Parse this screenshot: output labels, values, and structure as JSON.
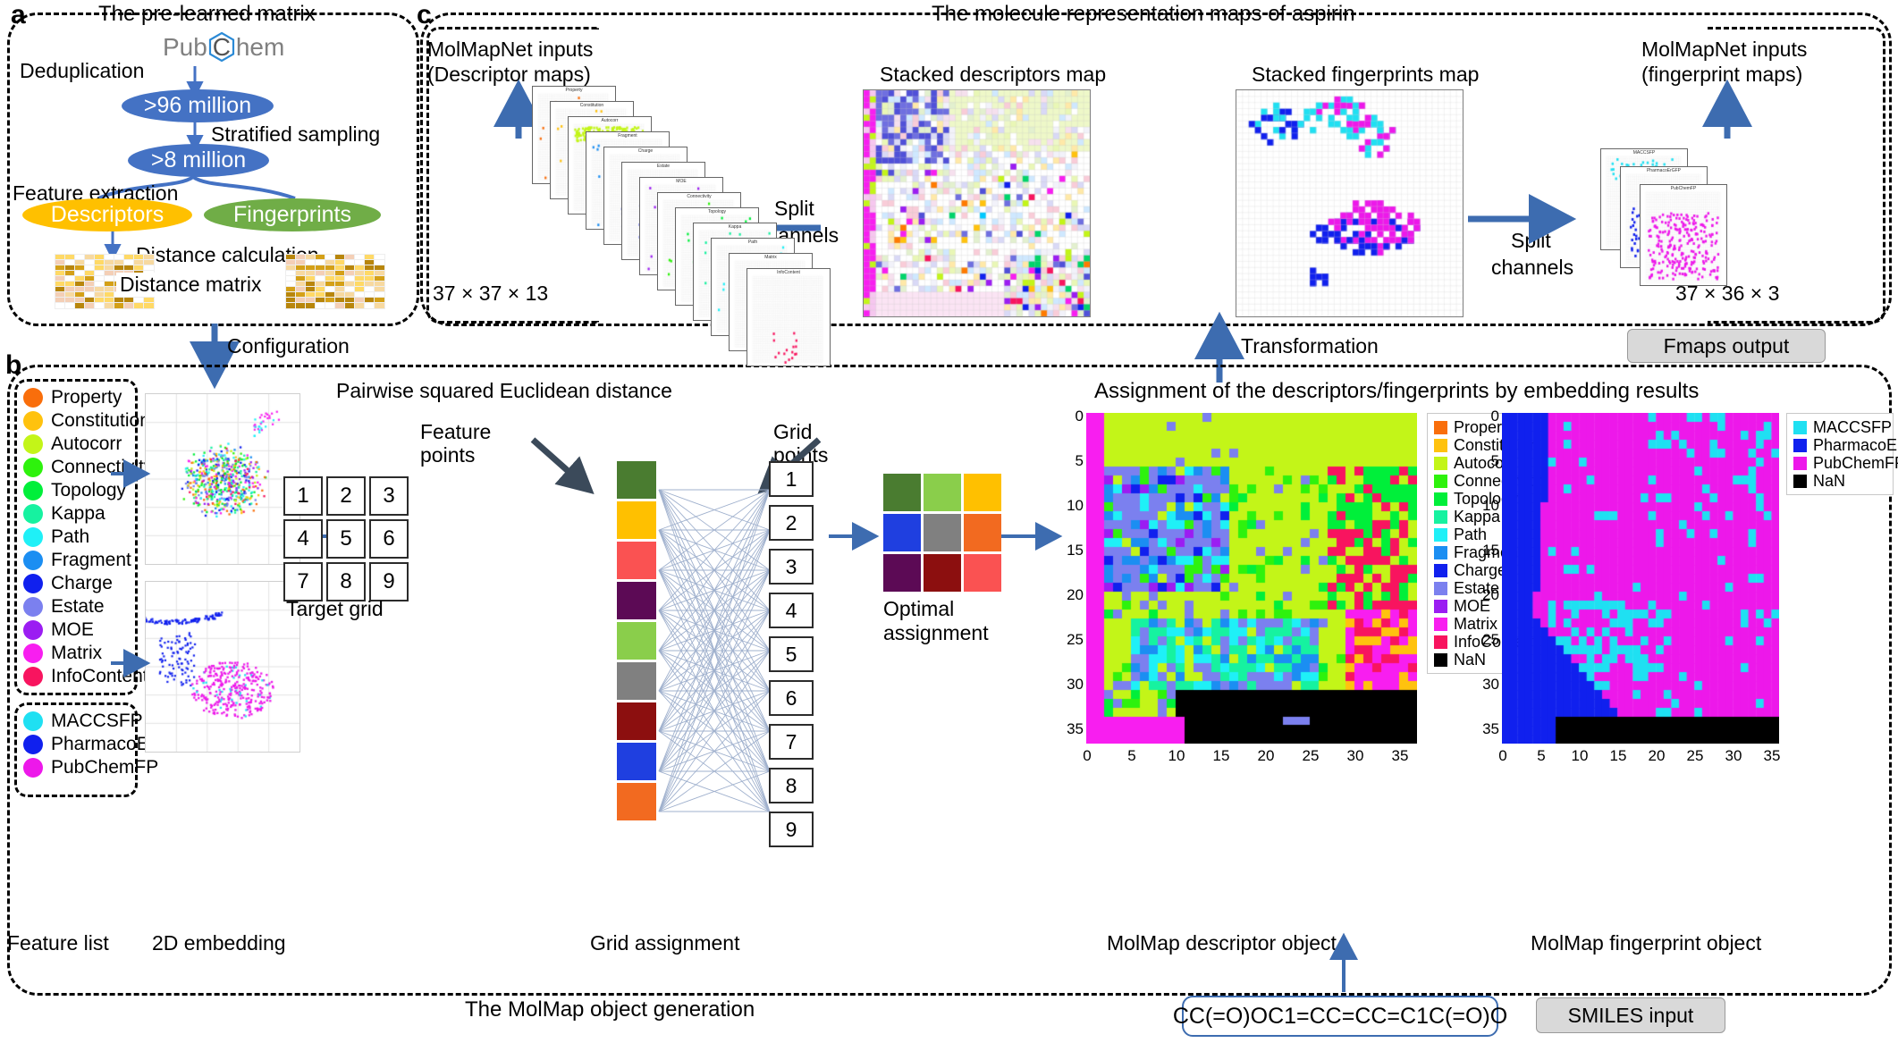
{
  "panels": {
    "a": {
      "letter": "a",
      "title": "The pre-learned matrix"
    },
    "b": {
      "letter": "b"
    },
    "c": {
      "letter": "c",
      "title": "The molecule representation maps of aspirin"
    }
  },
  "panel_a": {
    "source_label": "PubChem",
    "source_prefix": "Pub",
    "source_atom": "C",
    "source_suffix": "hem",
    "step1": "Deduplication",
    "node1": "&gt;96 million",
    "step2": "Stratified sampling",
    "node2": "&gt;8 million",
    "step3": "Feature extraction",
    "branch_left": "Descriptors",
    "branch_right": "Fingerprints",
    "step4": "Distance calculation",
    "matrix_label": "Distance matrix",
    "configuration": "Configuration"
  },
  "panel_b": {
    "feature_list_label": "Feature list",
    "embedding_label": "2D embedding",
    "grid_assignment_label": "Grid assignment",
    "target_grid_label": "Target grid",
    "pairwise_label": "Pairwise squared Euclidean distance",
    "feature_points_label": "Feature points",
    "grid_points_label": "Grid points",
    "optimal_label": "Optimal assignment",
    "assignment_title": "Assignment of the descriptors/fingerprints by embedding results",
    "descriptor_object_label": "MolMap descriptor object",
    "fingerprint_object_label": "MolMap fingerprint object",
    "generation_label": "The MolMap object generation",
    "smiles": "CC(=O)OC1=CC=CC=C1C(=O)O",
    "smiles_tag": "SMILES input",
    "target_grid_cells": [
      "1",
      "2",
      "3",
      "4",
      "5",
      "6",
      "7",
      "8",
      "9"
    ],
    "grid_points_cells": [
      "1",
      "2",
      "3",
      "4",
      "5",
      "6",
      "7",
      "8",
      "9"
    ],
    "feature_point_colors": [
      "#4a7c30",
      "#ffc000",
      "#fa5252",
      "#5c0a55",
      "#8ace4b",
      "#808080",
      "#8c0f0f",
      "#1f3fe0",
      "#f26a20"
    ],
    "optimal_colors": [
      "#4a7c30",
      "#8ace4b",
      "#ffc000",
      "#1f3fe0",
      "#808080",
      "#f26a20",
      "#5c0a55",
      "#8c0f0f",
      "#fa5252"
    ],
    "descriptor_axis_ticks": [
      "0",
      "5",
      "10",
      "15",
      "20",
      "25",
      "30",
      "35"
    ],
    "fingerprint_axis_ticks": [
      "0",
      "5",
      "10",
      "15",
      "20",
      "25",
      "30",
      "35"
    ]
  },
  "panel_c": {
    "descriptor_input_title_l1": "MolMapNet inputs",
    "descriptor_input_title_l2": "(Descriptor maps)",
    "descriptor_dims": "37 × 37 × 13",
    "stacked_descriptors_title": "Stacked descriptors map",
    "stacked_fingerprints_title": "Stacked fingerprints map",
    "fingerprint_input_title_l1": "MolMapNet inputs",
    "fingerprint_input_title_l2": "(fingerprint maps)",
    "fingerprint_dims": "37 × 36 × 3",
    "split_channels_left_l1": "Split",
    "split_channels_left_l2": "channels",
    "split_channels_right_l1": "Split",
    "split_channels_right_l2": "channels",
    "transformation_label": "Transformation",
    "fmaps_tag": "Fmaps output",
    "descriptor_card_labels": [
      "Property",
      "Constitution",
      "Autocorr",
      "Fragment",
      "Charge",
      "Estate",
      "MOE",
      "Connectivity",
      "Topology",
      "Kappa",
      "Path",
      "Matrix",
      "InfoContent"
    ],
    "fingerprint_card_labels": [
      "MACCSFP",
      "PharmacoErGFP",
      "PubChemFP"
    ]
  },
  "feature_list": {
    "descriptors": [
      {
        "label": "Property",
        "color": "#f96e0b"
      },
      {
        "label": "Constitution",
        "color": "#ffc20e"
      },
      {
        "label": "Autocorr",
        "color": "#c3f518"
      },
      {
        "label": "Connectivity",
        "color": "#2ef20d"
      },
      {
        "label": "Topology",
        "color": "#00ef3a"
      },
      {
        "label": "Kappa",
        "color": "#16f2a0"
      },
      {
        "label": "Path",
        "color": "#1ff0f7"
      },
      {
        "label": "Fragment",
        "color": "#1b8ef2"
      },
      {
        "label": "Charge",
        "color": "#1020ee"
      },
      {
        "label": "Estate",
        "color": "#7b80ef"
      },
      {
        "label": "MOE",
        "color": "#9b1df2"
      },
      {
        "label": "Matrix",
        "color": "#f81ef0"
      },
      {
        "label": "InfoContent",
        "color": "#f8145f"
      }
    ],
    "fingerprints": [
      {
        "label": "MACCSFP",
        "color": "#1fe0f2"
      },
      {
        "label": "PharmacoErGFP",
        "color": "#1020ee"
      },
      {
        "label": "PubChemFP",
        "color": "#ed18ea"
      }
    ]
  },
  "descriptor_legend": {
    "items": [
      {
        "label": "Property",
        "color": "#f96e0b"
      },
      {
        "label": "Constitution",
        "color": "#ffc20e"
      },
      {
        "label": "Autocorr",
        "color": "#c3f518"
      },
      {
        "label": "Connectivity",
        "color": "#2ef20d"
      },
      {
        "label": "Topology",
        "color": "#00ef3a"
      },
      {
        "label": "Kappa",
        "color": "#16f2a0"
      },
      {
        "label": "Path",
        "color": "#1ff0f7"
      },
      {
        "label": "Fragment",
        "color": "#1b8ef2"
      },
      {
        "label": "Charge",
        "color": "#1020ee"
      },
      {
        "label": "Estate",
        "color": "#7b80ef"
      },
      {
        "label": "MOE",
        "color": "#9b1df2"
      },
      {
        "label": "Matrix",
        "color": "#f81ef0"
      },
      {
        "label": "InfoContent",
        "color": "#f8145f"
      },
      {
        "label": "NaN",
        "color": "#000000"
      }
    ]
  },
  "fingerprint_legend": {
    "items": [
      {
        "label": "MACCSFP",
        "color": "#1fe0f2"
      },
      {
        "label": "PharmacoErGFP",
        "color": "#1020ee"
      },
      {
        "label": "PubChemFP",
        "color": "#ed18ea"
      },
      {
        "label": "NaN",
        "color": "#000000"
      }
    ]
  },
  "colors": {
    "arrow_blue": "#3d6cb0",
    "node_blue": "#4472c4",
    "descriptors_orange": "#ffc000",
    "fingerprints_green": "#70ad47",
    "dark_arrow": "#3b4a5a"
  }
}
